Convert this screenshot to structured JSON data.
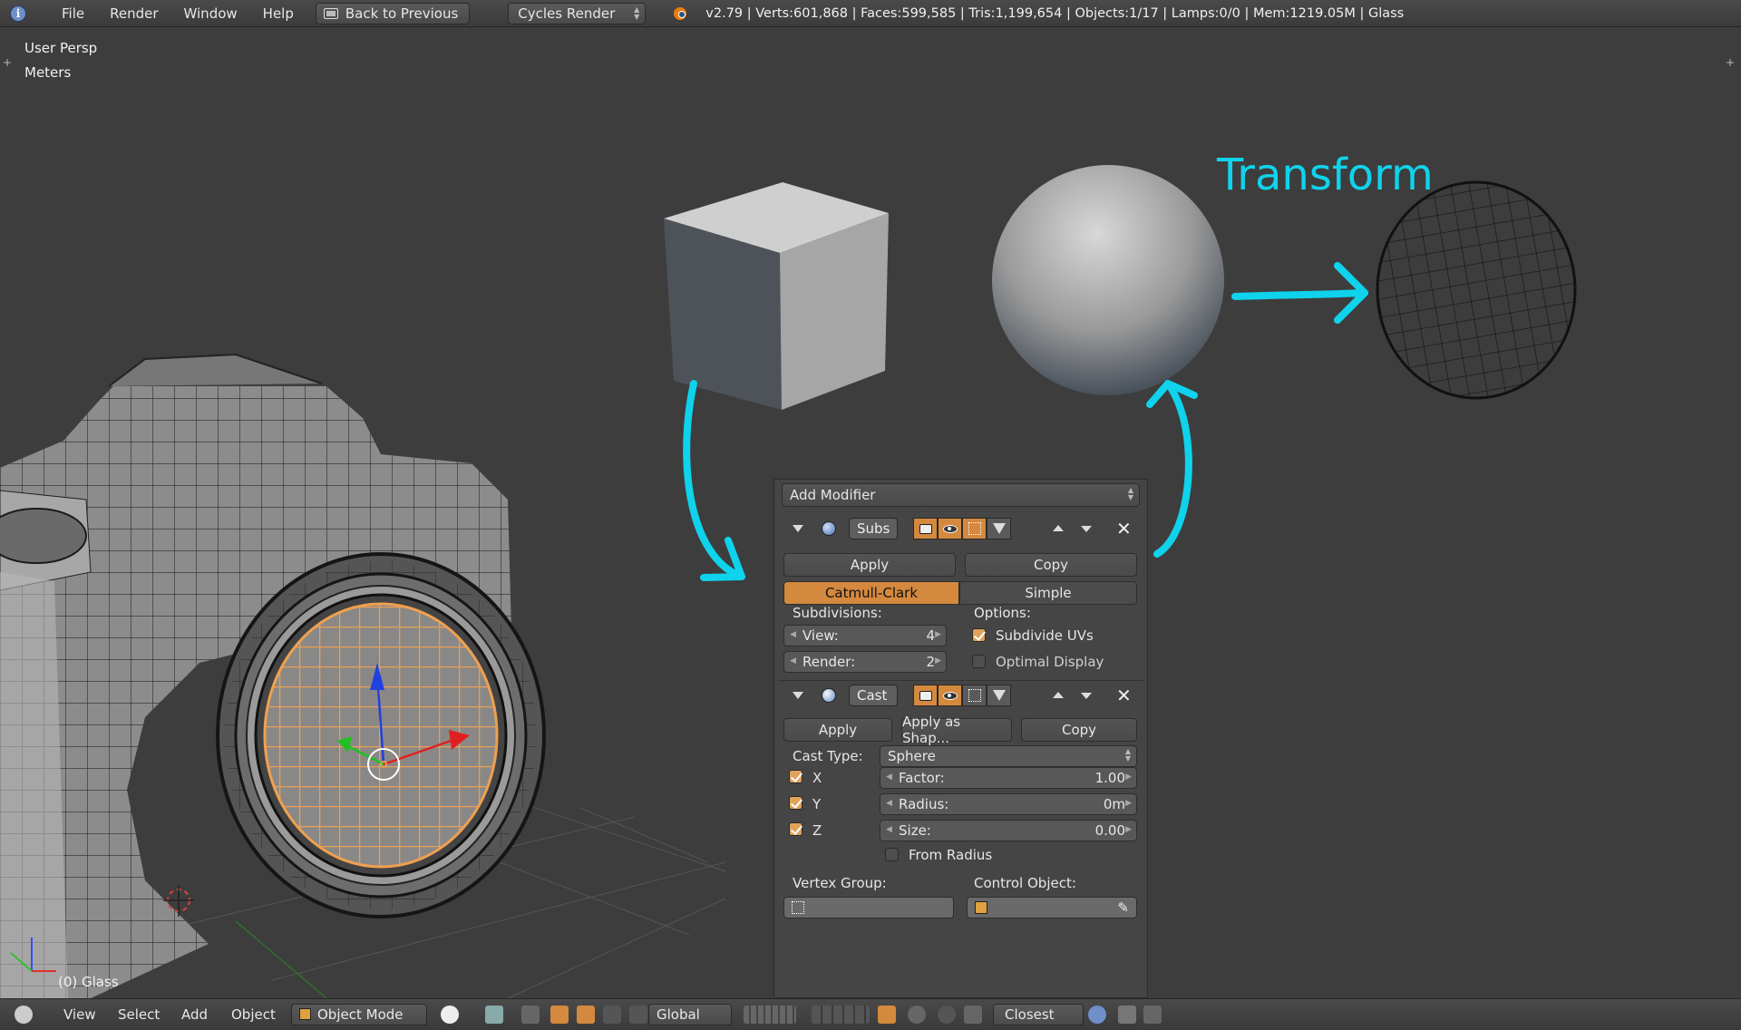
{
  "topbar": {
    "menus": [
      "File",
      "Render",
      "Window",
      "Help"
    ],
    "back_button": "Back to Previous",
    "render_engine": "Cycles Render",
    "stats": "v2.79 | Verts:601,868 | Faces:599,585 | Tris:1,199,654 | Objects:1/17 | Lamps:0/0 | Mem:1219.05M | Glass"
  },
  "viewport": {
    "view_name": "User Persp",
    "units": "Meters",
    "active_object": "(0) Glass",
    "annotation": "Transform"
  },
  "modifier_panel": {
    "add_modifier": "Add Modifier",
    "subsurf": {
      "name": "Subs",
      "apply": "Apply",
      "copy": "Copy",
      "mode_catmull": "Catmull-Clark",
      "mode_simple": "Simple",
      "subdivisions_label": "Subdivisions:",
      "view_label": "View:",
      "view_value": "4",
      "render_label": "Render:",
      "render_value": "2",
      "options_label": "Options:",
      "subdivide_uvs": "Subdivide UVs",
      "subdivide_uvs_checked": true,
      "optimal_display": "Optimal Display",
      "optimal_display_checked": false
    },
    "cast": {
      "name": "Cast",
      "apply": "Apply",
      "apply_as_shape": "Apply as Shap...",
      "copy": "Copy",
      "cast_type_label": "Cast Type:",
      "cast_type_value": "Sphere",
      "x": "X",
      "y": "Y",
      "z": "Z",
      "factor_label": "Factor:",
      "factor_value": "1.00",
      "radius_label": "Radius:",
      "radius_value": "0m",
      "size_label": "Size:",
      "size_value": "0.00",
      "from_radius": "From Radius",
      "vertex_group_label": "Vertex Group:",
      "control_object_label": "Control Object:"
    }
  },
  "bottombar": {
    "view": "View",
    "select": "Select",
    "add": "Add",
    "object": "Object",
    "mode": "Object Mode",
    "orientation": "Global",
    "snap": "Closest"
  },
  "colors": {
    "annotation": "#0fd3ec",
    "active_orange": "#d4893e",
    "background": "#3d3d3d"
  }
}
